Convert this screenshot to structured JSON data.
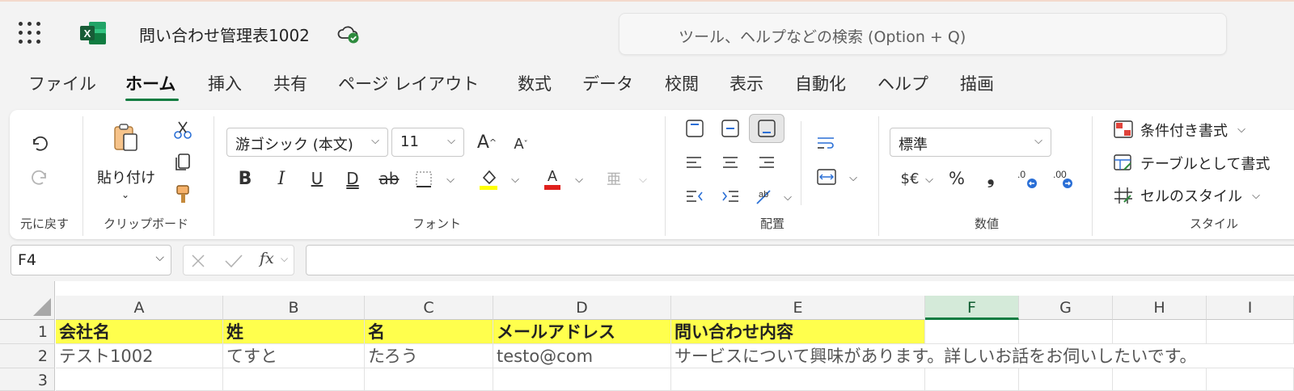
{
  "app": {
    "doc_title": "問い合わせ管理表1002",
    "search_placeholder": "ツール、ヘルプなどの検索 (Option + Q)"
  },
  "menu": {
    "tabs": [
      "ファイル",
      "ホーム",
      "挿入",
      "共有",
      "ページ レイアウト",
      "数式",
      "データ",
      "校閲",
      "表示",
      "自動化",
      "ヘルプ",
      "描画"
    ],
    "active": "ホーム"
  },
  "ribbon": {
    "undo_group": "元に戻す",
    "clipboard": {
      "paste_label": "貼り付け",
      "group": "クリップボード"
    },
    "font": {
      "font_name": "游ゴシック (本文)",
      "font_size": "11",
      "group": "フォント",
      "phonetic_glyph": "亜"
    },
    "alignment": {
      "group": "配置"
    },
    "number": {
      "format": "標準",
      "group": "数値",
      "currency": "$€",
      "percent": "%",
      "comma": "❟"
    },
    "styles": {
      "conditional": "条件付き書式",
      "table": "テーブルとして書式",
      "cell_styles": "セルのスタイル",
      "group": "スタイル"
    }
  },
  "formula_bar": {
    "name_box": "F4",
    "formula": "",
    "fx": "fx"
  },
  "sheet": {
    "selected_column": "F",
    "columns": [
      "A",
      "B",
      "C",
      "D",
      "E",
      "F",
      "G",
      "H",
      "I"
    ],
    "row_numbers": [
      "1",
      "2",
      "3"
    ],
    "header_row": [
      "会社名",
      "姓",
      "名",
      "メールアドレス",
      "問い合わせ内容"
    ],
    "data_row": [
      "テスト1002",
      "てすと",
      "たろう",
      "testo@com",
      "サービスについて興味があります。詳しいお話をお伺いしたいです。"
    ]
  },
  "colors": {
    "accent": "#107c41",
    "highlight": "#ffff4d",
    "selected_header": "#d4ead9"
  }
}
